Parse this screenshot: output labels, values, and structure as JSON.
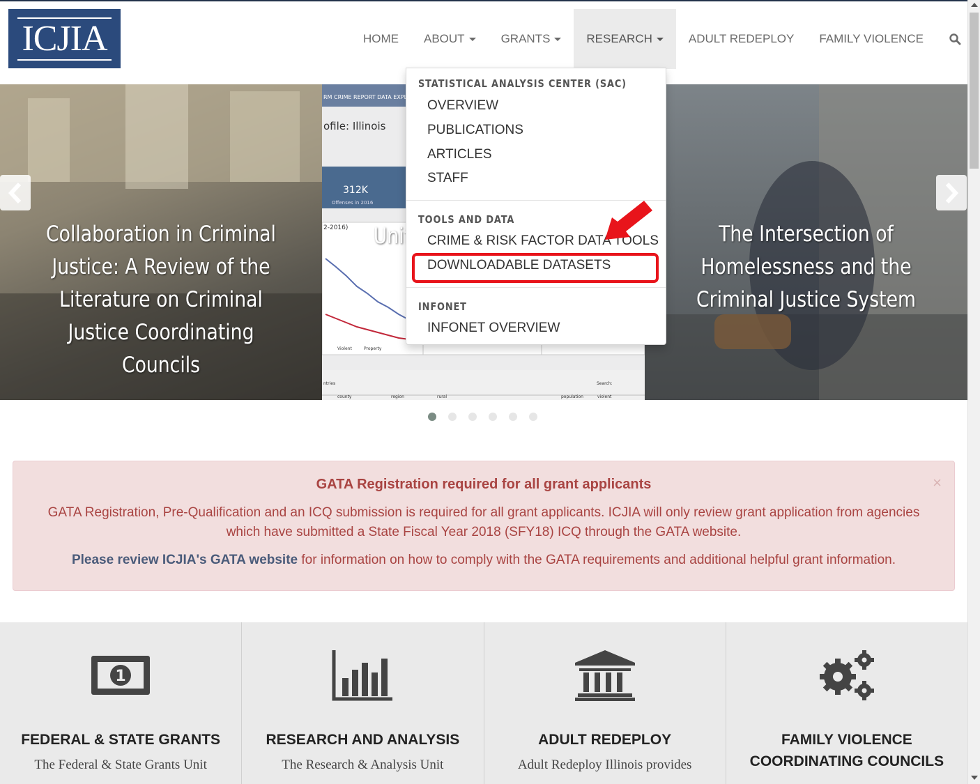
{
  "brand": {
    "logo_text": "ICJIA",
    "color": "#2b4a7c"
  },
  "nav": {
    "items": [
      {
        "label": "HOME",
        "dropdown": false
      },
      {
        "label": "ABOUT",
        "dropdown": true
      },
      {
        "label": "GRANTS",
        "dropdown": true
      },
      {
        "label": "RESEARCH",
        "dropdown": true,
        "active": true
      },
      {
        "label": "ADULT REDEPLOY",
        "dropdown": false
      },
      {
        "label": "FAMILY VIOLENCE",
        "dropdown": false
      }
    ],
    "search_icon": "search-icon"
  },
  "dropdown": {
    "sections": [
      {
        "header": "STATISTICAL ANALYSIS CENTER (SAC)",
        "items": [
          "OVERVIEW",
          "PUBLICATIONS",
          "ARTICLES",
          "STAFF"
        ]
      },
      {
        "header": "TOOLS AND DATA",
        "items": [
          "CRIME & RISK FACTOR DATA TOOLS",
          "DOWNLOADABLE DATASETS"
        ]
      },
      {
        "header": "INFONET",
        "items": [
          "INFONET OVERVIEW"
        ]
      }
    ],
    "highlighted_item": "DOWNLOADABLE DATASETS",
    "highlight_color": "#e8141b"
  },
  "carousel": {
    "slides": [
      {
        "caption": "Collaboration in Criminal Justice: A Review of the Literature on Criminal Justice Coordinating Councils"
      },
      {
        "caption": "Unifo",
        "screenshot": {
          "header": "RM CRIME REPORT DATA EXPLORER",
          "profile": "ofile: Illinois",
          "stat": "312K",
          "stat_label": "Offenses in 2016",
          "year_range": "2-2016)",
          "legend_a": "Violent",
          "legend_b": "Property",
          "search_label": "Search:",
          "columns": [
            "county",
            "region",
            "rural",
            "population",
            "violent"
          ],
          "row_label": "ntries"
        }
      },
      {
        "caption": "The Intersection of Homelessness and the Criminal Justice System"
      }
    ],
    "dot_count": 6,
    "active_dot": 0
  },
  "alert": {
    "title": "GATA Registration required for all grant applicants",
    "body": "GATA Registration, Pre-Qualification and an ICQ submission is required for all grant applicants. ICJIA will only review grant application from agencies which have submitted a State Fiscal Year 2018 (SFY18) ICQ through the GATA website.",
    "link_text": "Please review ICJIA's GATA website",
    "footer_text": " for information on how to comply with the GATA requirements and additional helpful grant information.",
    "close_glyph": "×"
  },
  "features": [
    {
      "icon": "money-icon",
      "title": "FEDERAL & STATE GRANTS",
      "text": "The Federal & State Grants Unit"
    },
    {
      "icon": "bar-chart-icon",
      "title": "RESEARCH AND ANALYSIS",
      "text": "The Research & Analysis Unit"
    },
    {
      "icon": "institution-icon",
      "title": "ADULT REDEPLOY",
      "text": "Adult Redeploy Illinois provides"
    },
    {
      "icon": "gears-icon",
      "title": "FAMILY VIOLENCE COORDINATING COUNCILS",
      "text": ""
    }
  ]
}
